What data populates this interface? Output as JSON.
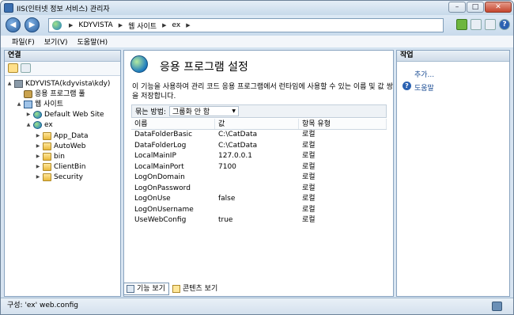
{
  "window": {
    "title": "IIS(인터넷 정보 서비스) 관리자"
  },
  "nav": {
    "breadcrumbs": [
      "KDYVISTA",
      "웹 사이트",
      "ex"
    ]
  },
  "menu": [
    "파일(F)",
    "보기(V)",
    "도움말(H)"
  ],
  "left": {
    "header": "연결",
    "tree": [
      {
        "label": "KDYVISTA(kdyvista\\kdy)",
        "icon": "server-icon",
        "expanded": true
      },
      {
        "label": "응용 프로그램 풀",
        "icon": "app-pool-icon"
      },
      {
        "label": "웹 사이트",
        "icon": "sites-icon",
        "expanded": true
      },
      {
        "label": "Default Web Site",
        "icon": "globe-icon"
      },
      {
        "label": "ex",
        "icon": "globe-icon",
        "expanded": true
      },
      {
        "label": "App_Data",
        "icon": "folder-icon"
      },
      {
        "label": "AutoWeb",
        "icon": "folder-icon"
      },
      {
        "label": "bin",
        "icon": "folder-icon"
      },
      {
        "label": "ClientBin",
        "icon": "folder-icon"
      },
      {
        "label": "Security",
        "icon": "folder-icon"
      }
    ]
  },
  "main": {
    "title": "응용 프로그램 설정",
    "description": "이 기능을 사용하여 관리 코드 응용 프로그램에서 런타임에 사용할 수 있는 이름 및 값 쌍을 저장합니다.",
    "group_label": "묶는 방법:",
    "group_value": "그룹화 안 함",
    "columns": [
      "이름",
      "값",
      "항목 유형"
    ],
    "rows": [
      [
        "DataFolderBasic",
        "C:\\CatData",
        "로컬"
      ],
      [
        "DataFolderLog",
        "C:\\CatData",
        "로컬"
      ],
      [
        "LocalMainIP",
        "127.0.0.1",
        "로컬"
      ],
      [
        "LocalMainPort",
        "7100",
        "로컬"
      ],
      [
        "LogOnDomain",
        "",
        "로컬"
      ],
      [
        "LogOnPassword",
        "",
        "로컬"
      ],
      [
        "LogOnUse",
        "false",
        "로컬"
      ],
      [
        "LogOnUsername",
        "",
        "로컬"
      ],
      [
        "UseWebConfig",
        "true",
        "로컬"
      ]
    ],
    "tabs": [
      "기능 보기",
      "콘텐츠 보기"
    ]
  },
  "actions": {
    "header": "작업",
    "add": "추가...",
    "help": "도움말"
  },
  "status": {
    "text": "구성: 'ex' web.config"
  }
}
